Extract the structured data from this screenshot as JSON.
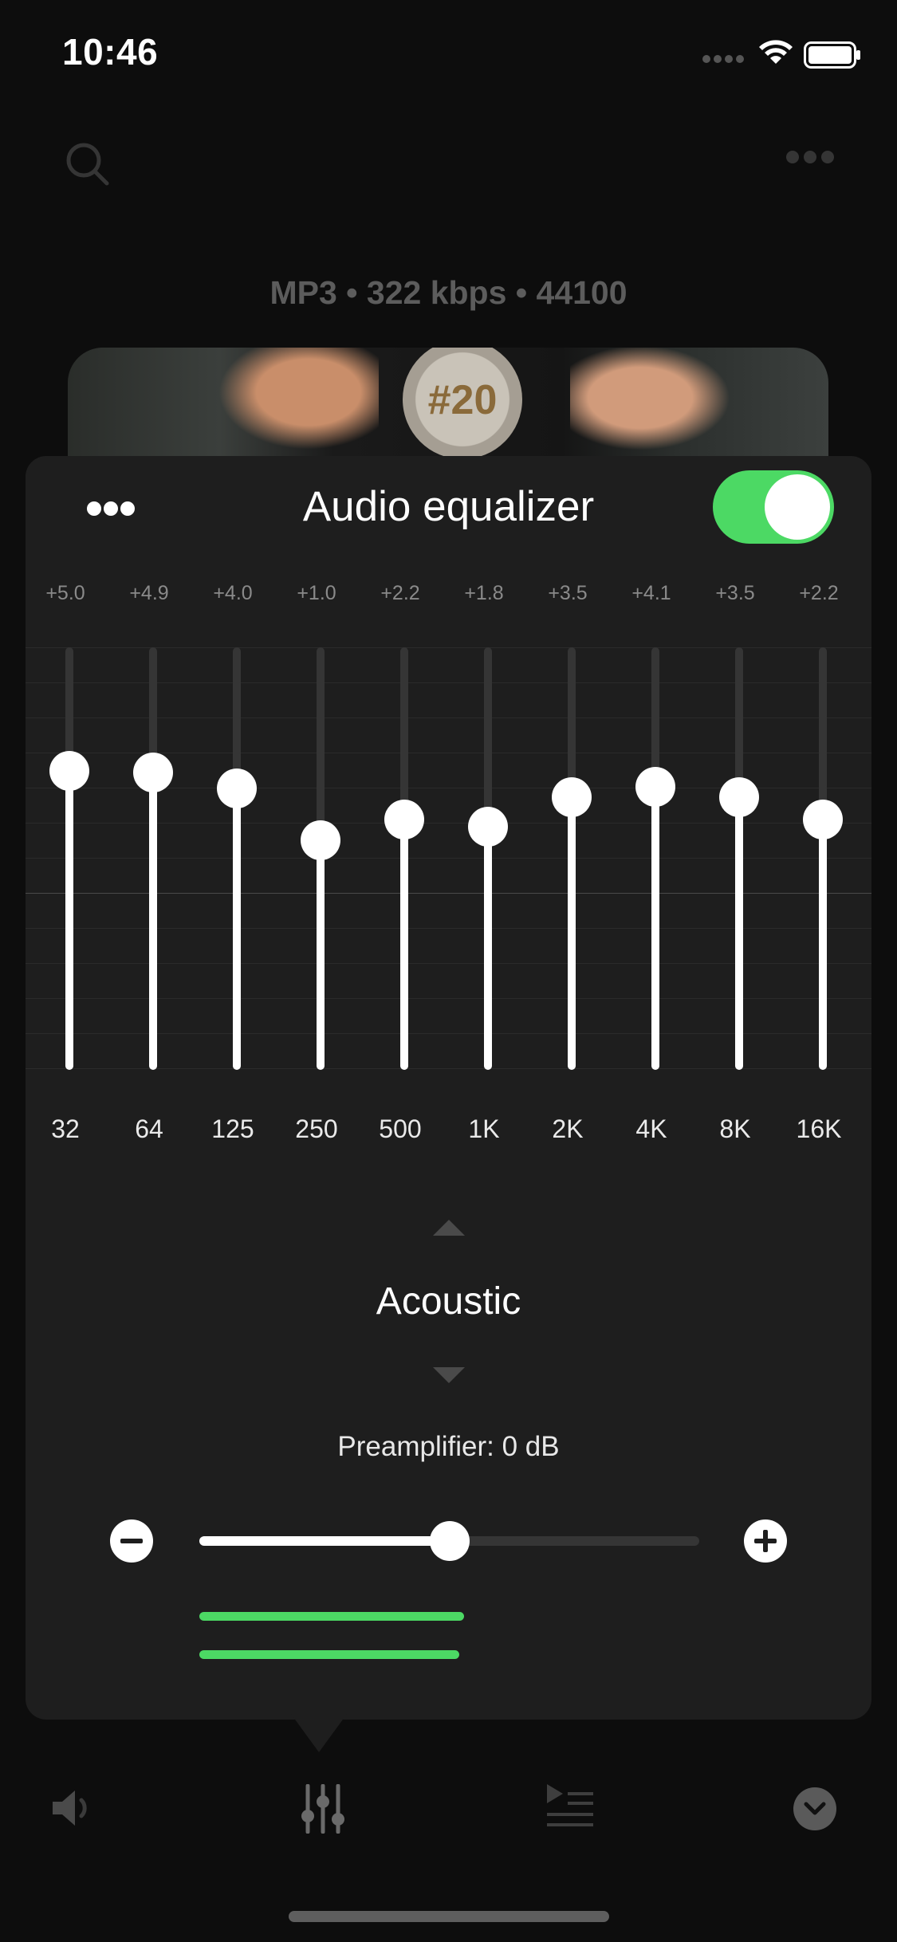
{
  "status": {
    "time": "10:46"
  },
  "background": {
    "format_info": "MP3 • 322 kbps • 44100",
    "art_label": "#20"
  },
  "panel": {
    "title": "Audio equalizer",
    "enabled": true,
    "accent": "#4cd964"
  },
  "eq": {
    "bands": [
      {
        "freq": "32",
        "gain_label": "+5.0",
        "gain": 5.0
      },
      {
        "freq": "64",
        "gain_label": "+4.9",
        "gain": 4.9
      },
      {
        "freq": "125",
        "gain_label": "+4.0",
        "gain": 4.0
      },
      {
        "freq": "250",
        "gain_label": "+1.0",
        "gain": 1.0
      },
      {
        "freq": "500",
        "gain_label": "+2.2",
        "gain": 2.2
      },
      {
        "freq": "1K",
        "gain_label": "+1.8",
        "gain": 1.8
      },
      {
        "freq": "2K",
        "gain_label": "+3.5",
        "gain": 3.5
      },
      {
        "freq": "4K",
        "gain_label": "+4.1",
        "gain": 4.1
      },
      {
        "freq": "8K",
        "gain_label": "+3.5",
        "gain": 3.5
      },
      {
        "freq": "16K",
        "gain_label": "+2.2",
        "gain": 2.2
      }
    ]
  },
  "preset": {
    "name": "Acoustic"
  },
  "preamp": {
    "label": "Preamplifier: 0 dB",
    "level_fraction": 0.5
  },
  "levels": {
    "left_fraction": 0.53,
    "right_fraction": 0.52
  },
  "icons": {
    "search": "search-icon",
    "more": "more-icon",
    "toggle": "toggle",
    "volume": "speaker-icon",
    "equalizer": "equalizer-icon",
    "queue": "queue-icon",
    "collapse": "chevron-down-icon"
  }
}
